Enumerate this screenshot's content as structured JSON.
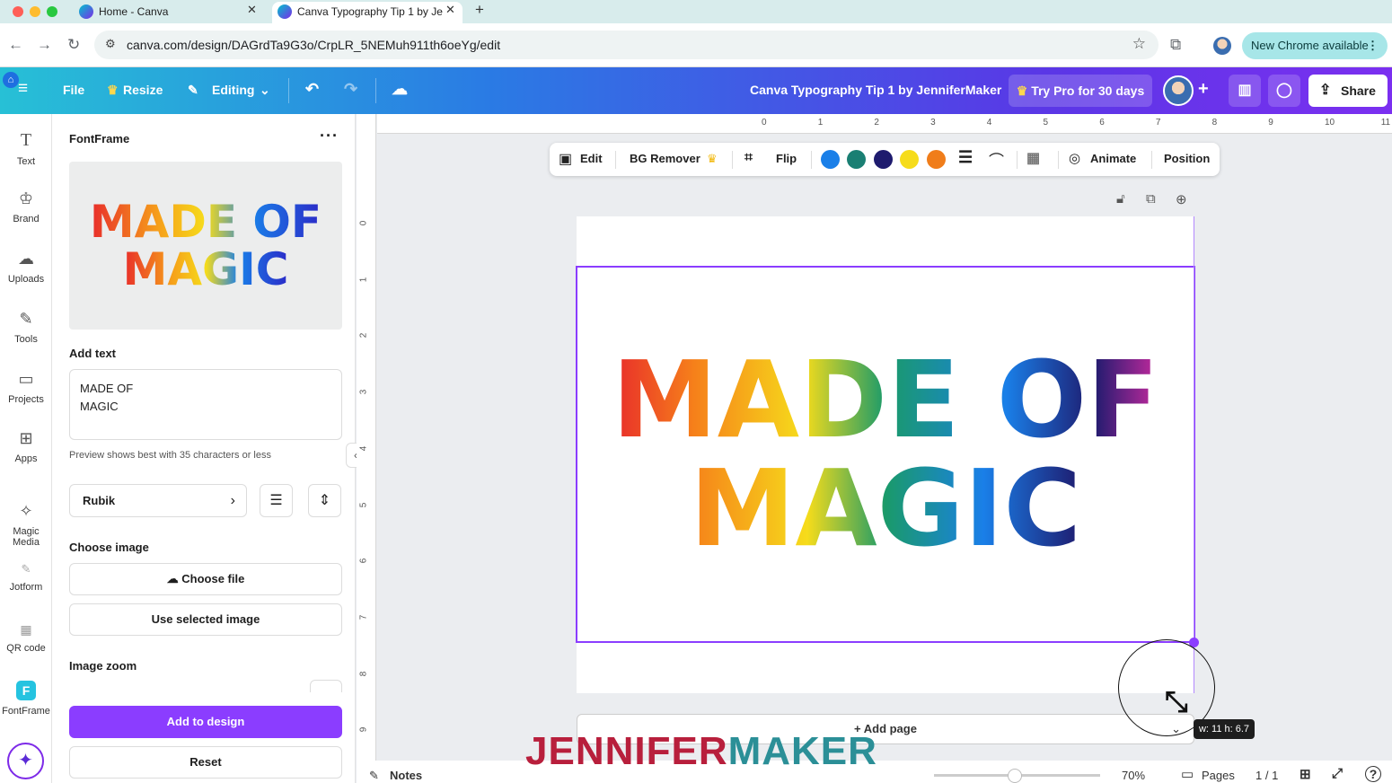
{
  "browser": {
    "tabs": [
      {
        "label": "Home - Canva",
        "active": false
      },
      {
        "label": "Canva Typography Tip 1 by Je",
        "active": true
      }
    ],
    "url": "canva.com/design/DAGrdTa9G3o/CrpLR_5NEMuh911th6oeYg/edit",
    "new_chrome": "New Chrome available"
  },
  "topbar": {
    "file": "File",
    "resize": "Resize",
    "editing": "Editing",
    "doc_title": "Canva Typography Tip 1 by JenniferMaker",
    "try_pro": "Try Pro for 30 days",
    "share": "Share"
  },
  "rail": {
    "items": [
      {
        "label": "Text",
        "icon": "T"
      },
      {
        "label": "Brand",
        "icon": "♔"
      },
      {
        "label": "Uploads",
        "icon": "☁"
      },
      {
        "label": "Tools",
        "icon": "✎"
      },
      {
        "label": "Projects",
        "icon": "▭"
      },
      {
        "label": "Apps",
        "icon": "⊞"
      },
      {
        "label": "Magic Media",
        "icon": "✧"
      },
      {
        "label": "Jotform",
        "icon": "✎"
      },
      {
        "label": "QR code",
        "icon": "▦"
      },
      {
        "label": "FontFrame",
        "icon": "F"
      }
    ]
  },
  "panel": {
    "title": "FontFrame",
    "preview_text": "MADE OF\nMAGIC",
    "add_text_label": "Add text",
    "text_value": "MADE OF\nMAGIC",
    "hint": "Preview shows best with 35 characters or less",
    "font": "Rubik",
    "choose_image_label": "Choose image",
    "choose_file": "Choose file",
    "use_selected": "Use selected image",
    "image_zoom_label": "Image zoom",
    "add_to_design": "Add to design",
    "reset": "Reset"
  },
  "context_toolbar": {
    "edit": "Edit",
    "bg_remover": "BG Remover",
    "flip": "Flip",
    "swatches": [
      "#1a7fe8",
      "#1a7f73",
      "#1e1b6e",
      "#f6dc1b",
      "#f07d1a"
    ],
    "animate": "Animate",
    "position": "Position"
  },
  "rulers": {
    "h": [
      "0",
      "1",
      "2",
      "3",
      "4",
      "5",
      "6",
      "7",
      "8",
      "9",
      "10",
      "11"
    ],
    "v": [
      "0",
      "1",
      "2",
      "3",
      "4",
      "5",
      "6",
      "7",
      "8",
      "9"
    ]
  },
  "canvas": {
    "line1": "MADE OF",
    "line2": "MAGIC",
    "add_page": "+ Add page",
    "dimension_tip": "w: 11 h: 6.7"
  },
  "footer": {
    "notes": "Notes",
    "zoom": "70%",
    "pages": "Pages",
    "page_count": "1 / 1"
  },
  "watermark": {
    "part1": "JENNIFER",
    "part2": "MAKER"
  }
}
